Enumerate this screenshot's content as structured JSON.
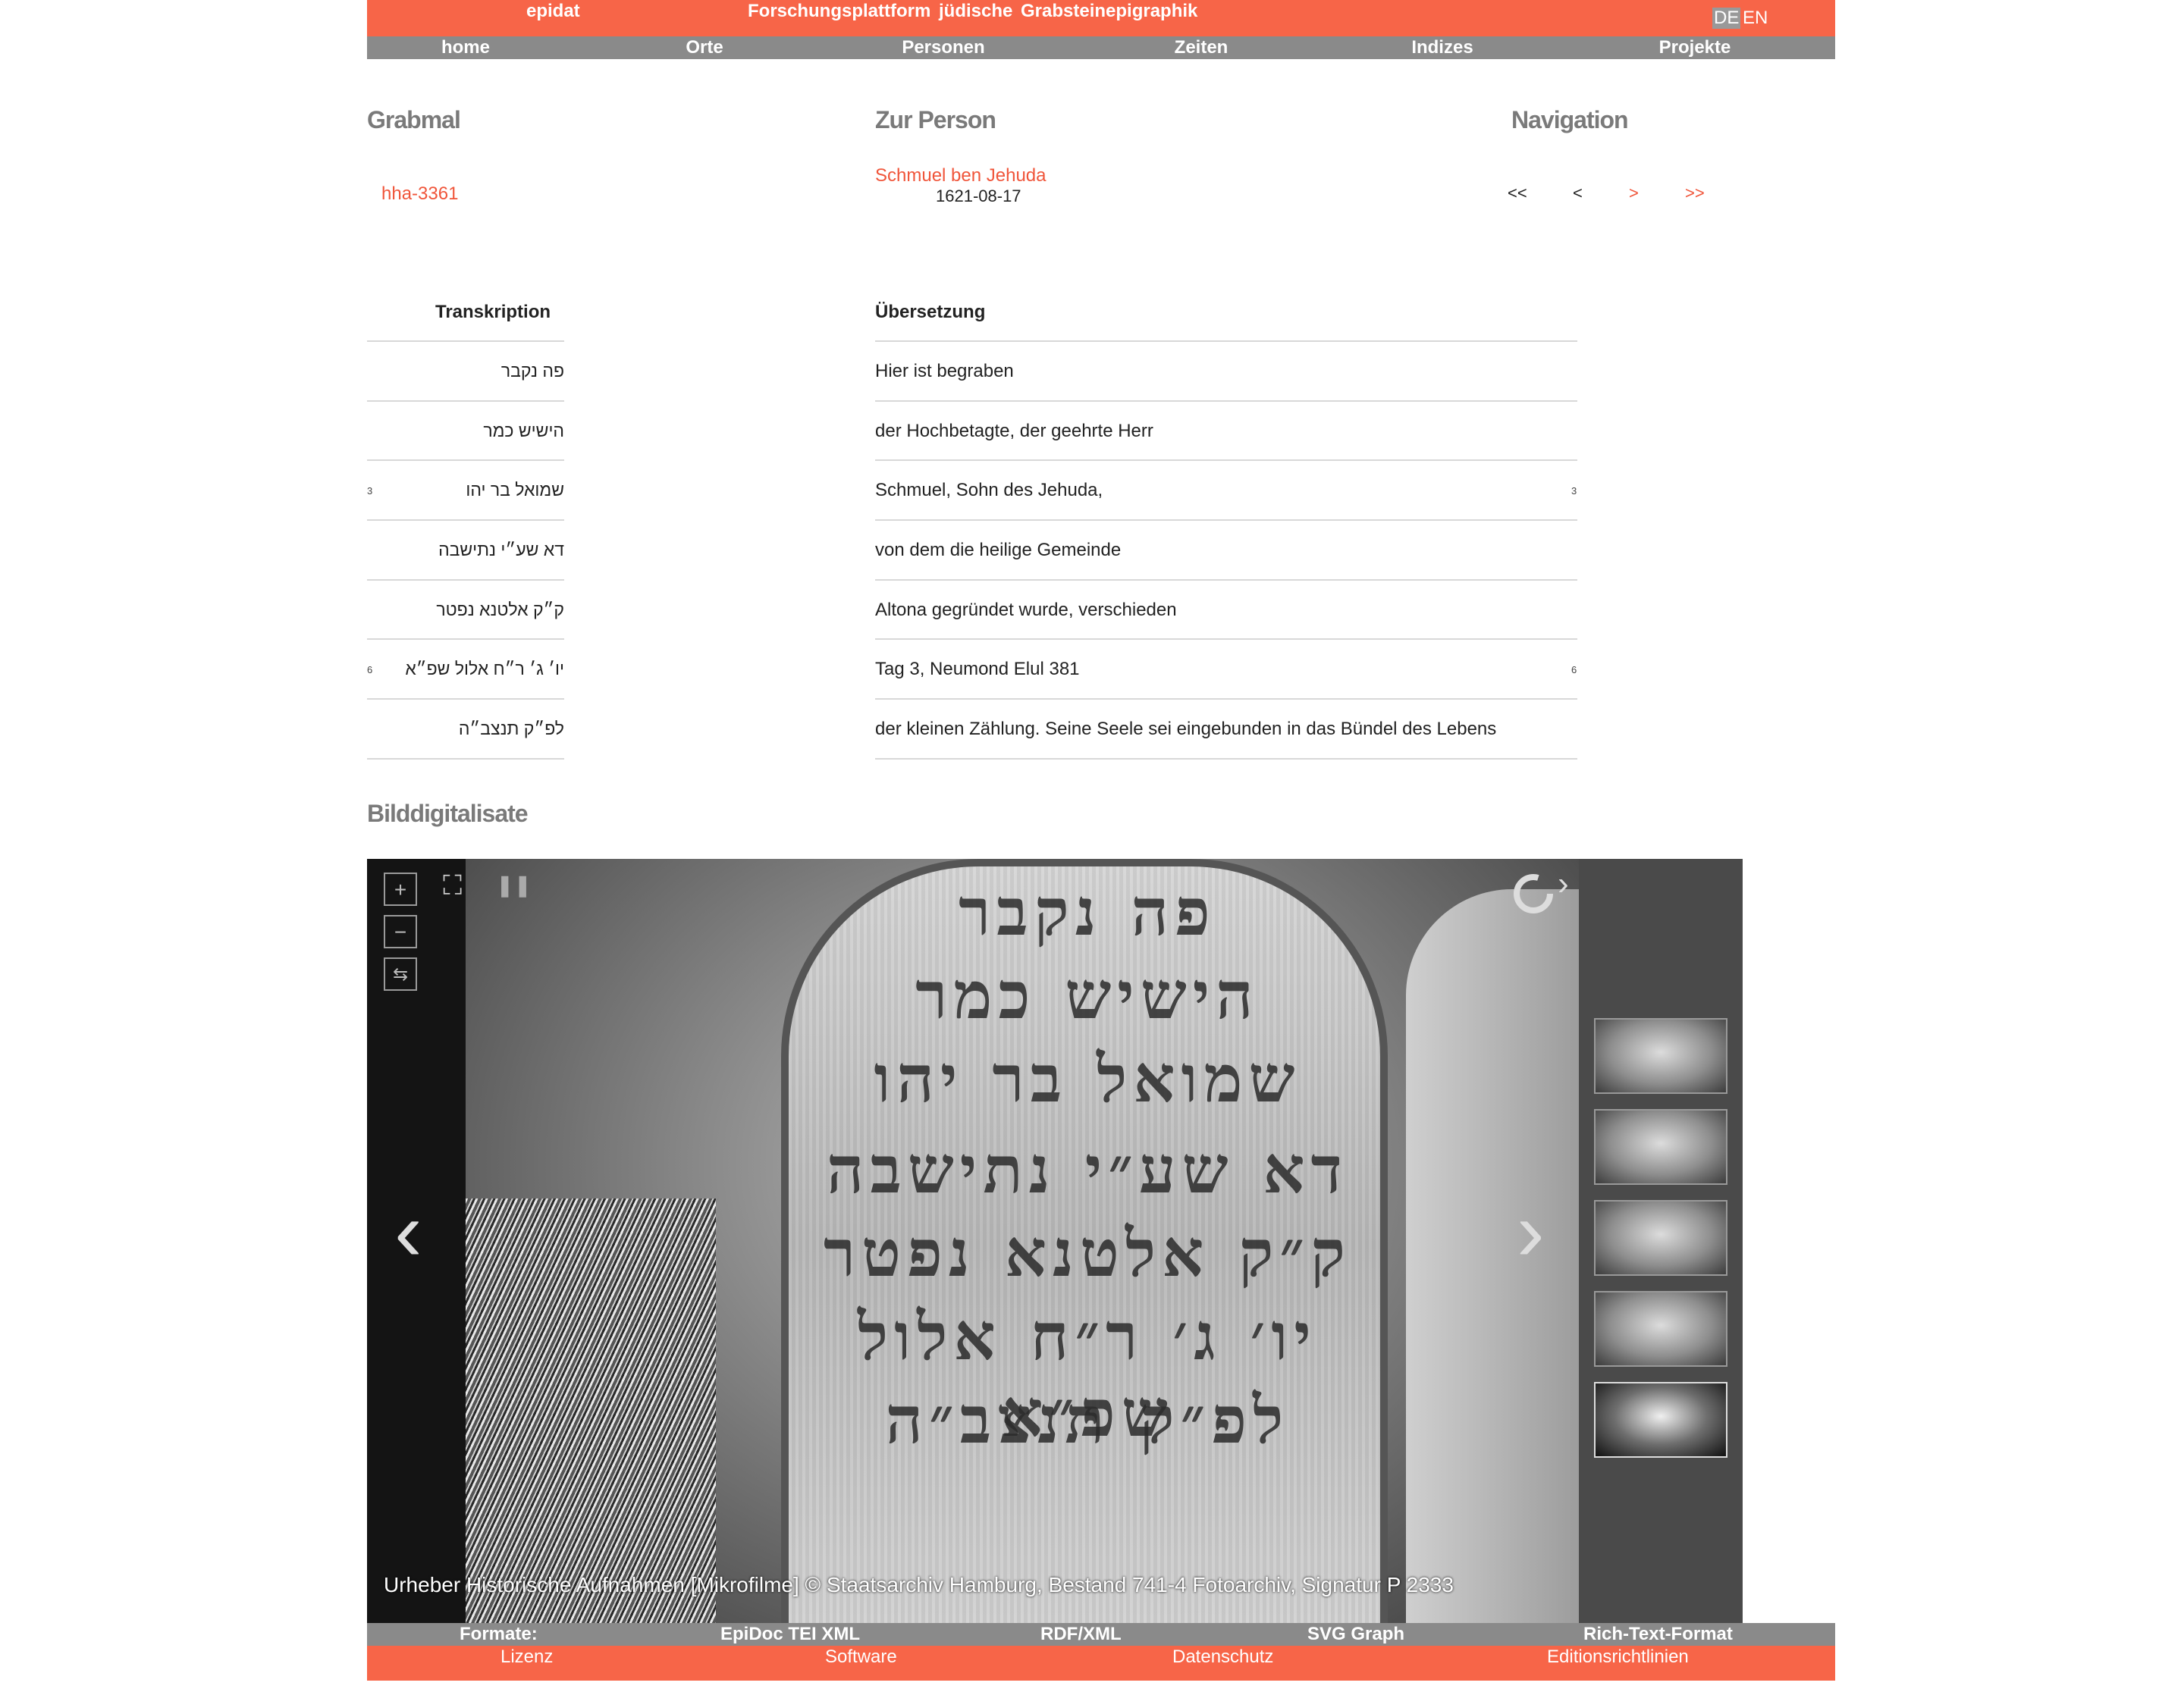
{
  "header": {
    "brand": "epidat",
    "tagline_1": "Forschungsplattform",
    "tagline_2": "jüdische",
    "tagline_3": "Grabsteinepigraphik",
    "lang_de": "DE",
    "lang_en": "EN"
  },
  "nav": [
    "home",
    "Orte",
    "Personen",
    "Zeiten",
    "Indizes",
    "Projekte"
  ],
  "grabmal": {
    "title": "Grabmal",
    "id": "hha-3361"
  },
  "person": {
    "title": "Zur Person",
    "name": "Schmuel ben Jehuda",
    "date": "1621-08-17"
  },
  "navigation": {
    "title": "Navigation",
    "first": "<<",
    "prev": "<",
    "next": ">",
    "last": ">>"
  },
  "transcription": {
    "header": "Transkription",
    "lines": [
      "פה נקבר",
      "הישיש כמר",
      "שמואל בר יהו",
      "דא שע״י נתישבה",
      "ק״ק אלטנא נפטר",
      "יו׳ ג׳ ר״ח אלול שפ״א",
      "לפ״ק תנצב״ה"
    ],
    "num_3": "3",
    "num_6": "6"
  },
  "translation": {
    "header": "Übersetzung",
    "lines": [
      "Hier ist begraben",
      "der Hochbetagte, der geehrte Herr",
      "Schmuel, Sohn des Jehuda,",
      "von dem die heilige Gemeinde",
      "Altona gegründet wurde, verschieden",
      "Tag 3, Neumond Elul 381",
      "der kleinen Zählung. Seine Seele sei eingebunden in das Bündel des Lebens"
    ],
    "num_3": "3",
    "num_6": "6"
  },
  "images": {
    "title": "Bilddigitalisate",
    "credit": "Urheber Historische Aufnahmen [Mikrofilme] © Staatsarchiv Hamburg, Bestand 741-4 Fotoarchiv, Signatur P 2333",
    "inscription": [
      "פה נקבר",
      "הישיש כמר",
      "שמואל בר יהו",
      "דא שע״י נתישבה",
      "ק״ק אלטנא נפטר",
      "יו׳ ג׳ ר״ח אלול שפ״א",
      "לפ״ק תנצב״ה"
    ],
    "zoom_in": "+",
    "zoom_out": "−",
    "rotate": "⇆",
    "fullscreen": "⛶",
    "pause": "❚❚",
    "prev_arrow": "‹",
    "next_arrow": "›",
    "panel_toggle": "›"
  },
  "formats": {
    "label": "Formate:",
    "items": [
      "EpiDoc TEI XML",
      "RDF/XML",
      "SVG Graph",
      "Rich-Text-Format"
    ]
  },
  "footer": [
    "Lizenz",
    "Software",
    "Datenschutz",
    "Editionsrichtlinien"
  ],
  "colors": {
    "accent": "#f76548",
    "bar_gray": "#8a8a8a",
    "link": "#f0553a"
  }
}
